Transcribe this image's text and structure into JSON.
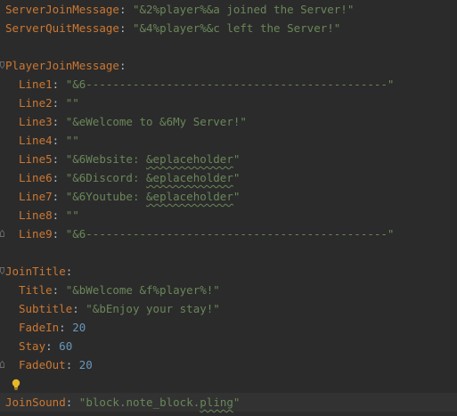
{
  "editor": {
    "language": "yaml",
    "colors": {
      "background": "#2b2b2b",
      "key": "#cc7832",
      "string": "#6a8759",
      "number": "#6897bb",
      "punctuation": "#a9b7c6",
      "current_line": "#323232",
      "bulb": "#e8b728"
    },
    "lines": [
      {
        "indent": 0,
        "key": "ServerJoinMessage",
        "sep": ": ",
        "val": "\"&2%player%&a joined the Server!\""
      },
      {
        "indent": 0,
        "key": "ServerQuitMessage",
        "sep": ": ",
        "val": "\"&4%player%&c left the Server!\""
      },
      {},
      {
        "indent": 0,
        "fold": "open",
        "key": "PlayerJoinMessage",
        "sep": ":"
      },
      {
        "indent": 1,
        "key": "Line1",
        "sep": ": ",
        "val": "\"&6---------------------------------------------\""
      },
      {
        "indent": 1,
        "key": "Line2",
        "sep": ": ",
        "val": "\"\""
      },
      {
        "indent": 1,
        "key": "Line3",
        "sep": ": ",
        "val": "\"&eWelcome to &6My Server!\""
      },
      {
        "indent": 1,
        "key": "Line4",
        "sep": ": ",
        "val": "\"\""
      },
      {
        "indent": 1,
        "key": "Line5",
        "sep": ": ",
        "val": "\"&6Website: ",
        "val_squiggle": "&eplaceholder",
        "val_tail": "\""
      },
      {
        "indent": 1,
        "key": "Line6",
        "sep": ": ",
        "val": "\"&6Discord: ",
        "val_squiggle": "&eplaceholder",
        "val_tail": "\""
      },
      {
        "indent": 1,
        "key": "Line7",
        "sep": ": ",
        "val": "\"&6Youtube: ",
        "val_squiggle": "&eplaceholder",
        "val_tail": "\""
      },
      {
        "indent": 1,
        "key": "Line8",
        "sep": ": ",
        "val": "\"\""
      },
      {
        "indent": 1,
        "fold": "close",
        "key": "Line9",
        "sep": ": ",
        "val": "\"&6---------------------------------------------\""
      },
      {},
      {
        "indent": 0,
        "fold": "open",
        "key": "JoinTitle",
        "sep": ":"
      },
      {
        "indent": 1,
        "key": "Title",
        "sep": ": ",
        "val": "\"&bWelcome &f%player%!\""
      },
      {
        "indent": 1,
        "key": "Subtitle",
        "sep": ": ",
        "val": "\"&bEnjoy your stay!\""
      },
      {
        "indent": 1,
        "key": "FadeIn",
        "sep": ": ",
        "num": "20"
      },
      {
        "indent": 1,
        "key": "Stay",
        "sep": ": ",
        "num": "60"
      },
      {
        "indent": 1,
        "fold": "close",
        "key": "FadeOut",
        "sep": ": ",
        "num": "20"
      },
      {},
      {
        "indent": 0,
        "current": true,
        "key": "JoinSound",
        "sep": ": ",
        "val": "\"block.note_block.",
        "val_squiggle": "pling",
        "val_tail": "\""
      }
    ],
    "intention_bulb_icon": "lightbulb-icon"
  }
}
